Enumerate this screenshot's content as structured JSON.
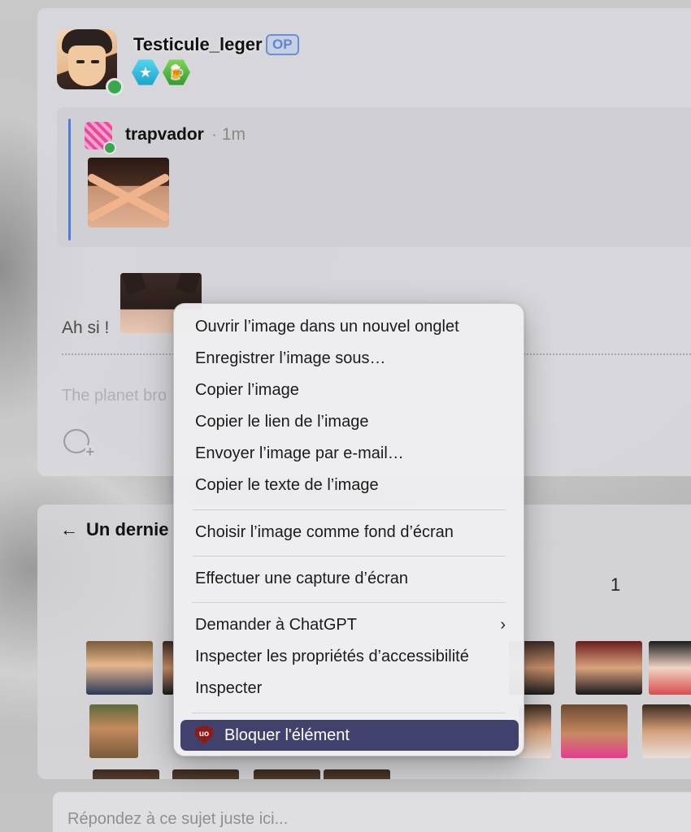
{
  "post": {
    "username": "Testicule_leger",
    "op_badge": "OP",
    "badges": [
      "star-badge-icon",
      "beer-badge-icon"
    ],
    "quote": {
      "username": "trapvador",
      "time": "· 1m"
    },
    "text": "Ah si !",
    "signature": "The planet bro"
  },
  "topic": {
    "title": "Un dernie",
    "page_count": "1"
  },
  "reply": {
    "placeholder": "Répondez à ce sujet juste ici..."
  },
  "context_menu": {
    "items": [
      "Ouvrir l’image dans un nouvel onglet",
      "Enregistrer l’image sous…",
      "Copier l’image",
      "Copier le lien de l’image",
      "Envoyer l’image par e-mail…",
      "Copier le texte de l’image",
      "Choisir l’image comme fond d’écran",
      "Effectuer une capture d’écran",
      "Demander à ChatGPT",
      "Inspecter les propriétés d’accessibilité",
      "Inspecter",
      "Bloquer l'élément"
    ],
    "submenu_chevron": "›",
    "ublock_icon_text": "uo"
  },
  "colors": {
    "accent_blue": "#4a7ee0",
    "online_green": "#3aa84a",
    "menu_highlight": "#41416e",
    "op_badge": "#5f86d2"
  }
}
